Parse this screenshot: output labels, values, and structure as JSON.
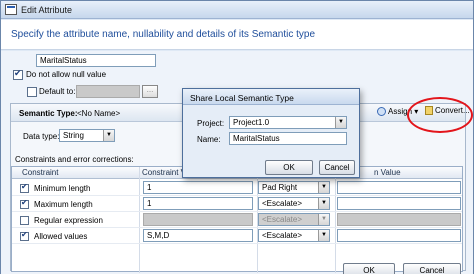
{
  "window": {
    "title": "Edit Attribute"
  },
  "header": {
    "instruction": "Specify the attribute name, nullability and details of its Semantic type"
  },
  "form": {
    "name_value": "MaritalStatus",
    "not_null_label": "Do not allow null value",
    "default_label": "Default to:",
    "default_value": ""
  },
  "semantic": {
    "label": "Semantic Type:",
    "value": "<No Name>",
    "assign_label": "Assign",
    "convert_label": "Convert...",
    "data_type_label": "Data type:",
    "data_type_value": "String",
    "constraints_label": "Constraints and error corrections:"
  },
  "grid": {
    "columns": [
      "Constraint",
      "Constraint Value",
      "",
      "n Value"
    ],
    "rows": [
      {
        "label": "Minimum length",
        "checked": true,
        "value": "1",
        "correction": "Pad Right",
        "correction_value": ""
      },
      {
        "label": "Maximum length",
        "checked": true,
        "value": "1",
        "correction": "<Escalate>",
        "correction_value": ""
      },
      {
        "label": "Regular expression",
        "checked": false,
        "value": "",
        "correction": "<Escalate>",
        "correction_value": ""
      },
      {
        "label": "Allowed values",
        "checked": true,
        "value": "S,M,D",
        "correction": "<Escalate>",
        "correction_value": ""
      }
    ]
  },
  "dialog": {
    "title": "Share Local Semantic Type",
    "project_label": "Project:",
    "project_value": "Project1.0",
    "name_label": "Name:",
    "name_value": "MaritalStatus",
    "ok_label": "OK",
    "cancel_label": "Cancel"
  },
  "bottom_buttons": {
    "ok_label": "OK",
    "cancel_label": "Cancel"
  },
  "colors": {
    "highlight": "#e3151b",
    "header_text": "#1f4e9b"
  }
}
